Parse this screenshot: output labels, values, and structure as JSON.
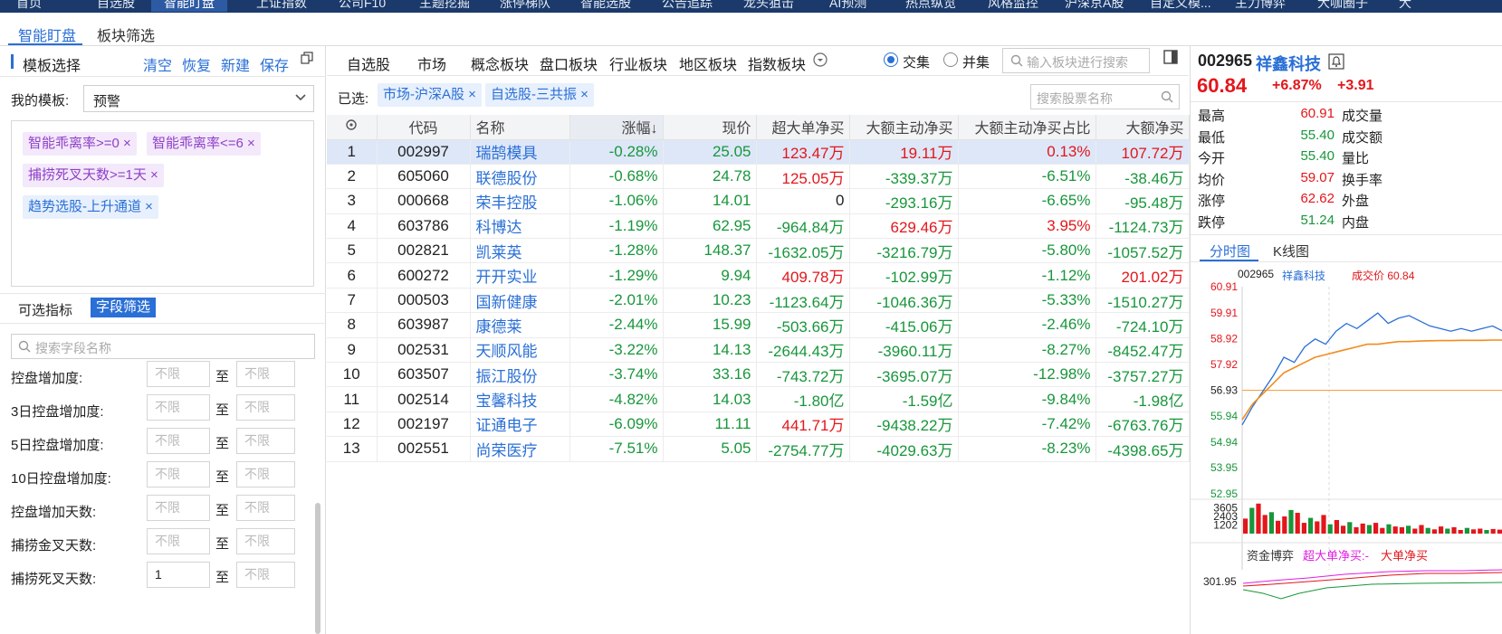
{
  "topnav": {
    "items": [
      "首页",
      "自选股",
      "智能盯盘",
      "上证指数",
      "公司F10",
      "主题挖掘",
      "涨停梯队",
      "智能选股",
      "公告追踪",
      "龙头狙击",
      "AI预测",
      "热点纵览",
      "风格监控",
      "沪深京A股",
      "自定义模...",
      "主力博弈",
      "大咖圈子",
      "大"
    ],
    "active_index": 2
  },
  "subtabs": {
    "items": [
      "智能盯盘",
      "板块筛选"
    ]
  },
  "left": {
    "template_title": "模板选择",
    "actions": [
      "清空",
      "恢复",
      "新建",
      "保存"
    ],
    "my_template_label": "我的模板:",
    "my_template_value": "预警",
    "chips": [
      {
        "text": "智能乖离率>=0 ×"
      },
      {
        "text": "智能乖离率<=6 ×"
      },
      {
        "text": "捕捞死叉天数>=1天 ×"
      },
      {
        "text": "趋势选股-上升通道 ×"
      }
    ],
    "tab_optional": "可选指标",
    "tab_field": "字段筛选",
    "search_placeholder": "搜索字段名称",
    "range_sep": "至",
    "range_placeholder": "不限",
    "fields": [
      {
        "label": "控盘增加度:",
        "min": ""
      },
      {
        "label": "3日控盘增加度:",
        "min": ""
      },
      {
        "label": "5日控盘增加度:",
        "min": ""
      },
      {
        "label": "10日控盘增加度:",
        "min": ""
      },
      {
        "label": "控盘增加天数:",
        "min": ""
      },
      {
        "label": "捕捞金叉天数:",
        "min": ""
      },
      {
        "label": "捕捞死叉天数:",
        "min": "1"
      }
    ]
  },
  "mid": {
    "tabs": [
      "自选股",
      "市场",
      "概念板块",
      "盘口板块",
      "行业板块",
      "地区板块",
      "指数板块"
    ],
    "radio_intersect": "交集",
    "radio_union": "并集",
    "block_search_placeholder": "输入板块进行搜索",
    "selected_label": "已选:",
    "selected_tags": [
      "市场-沪深A股 ×",
      "自选股-三共振 ×"
    ],
    "stock_search_placeholder": "搜索股票名称",
    "columns": [
      "代码",
      "名称",
      "涨幅↓",
      "现价",
      "超大单净买",
      "大额主动净买",
      "大额主动净买占比",
      "大额净买"
    ],
    "rows": [
      {
        "no": "1",
        "code": "002997",
        "name": "瑞鹄模具",
        "chg": "-0.28%",
        "price": "25.05",
        "sbig": "123.47万",
        "sbig_c": "r",
        "act": "19.11万",
        "act_c": "r",
        "ratio": "0.13%",
        "ratio_c": "r",
        "net": "107.72万",
        "net_c": "r"
      },
      {
        "no": "2",
        "code": "605060",
        "name": "联德股份",
        "chg": "-0.68%",
        "price": "24.78",
        "sbig": "125.05万",
        "sbig_c": "r",
        "act": "-339.37万",
        "act_c": "g",
        "ratio": "-6.51%",
        "ratio_c": "g",
        "net": "-38.46万",
        "net_c": "g"
      },
      {
        "no": "3",
        "code": "000668",
        "name": "荣丰控股",
        "chg": "-1.06%",
        "price": "14.01",
        "sbig": "0",
        "sbig_c": "k",
        "act": "-293.16万",
        "act_c": "g",
        "ratio": "-6.65%",
        "ratio_c": "g",
        "net": "-95.48万",
        "net_c": "g"
      },
      {
        "no": "4",
        "code": "603786",
        "name": "科博达",
        "chg": "-1.19%",
        "price": "62.95",
        "sbig": "-964.84万",
        "sbig_c": "g",
        "act": "629.46万",
        "act_c": "r",
        "ratio": "3.95%",
        "ratio_c": "r",
        "net": "-1124.73万",
        "net_c": "g"
      },
      {
        "no": "5",
        "code": "002821",
        "name": "凯莱英",
        "chg": "-1.28%",
        "price": "148.37",
        "sbig": "-1632.05万",
        "sbig_c": "g",
        "act": "-3216.79万",
        "act_c": "g",
        "ratio": "-5.80%",
        "ratio_c": "g",
        "net": "-1057.52万",
        "net_c": "g"
      },
      {
        "no": "6",
        "code": "600272",
        "name": "开开实业",
        "chg": "-1.29%",
        "price": "9.94",
        "sbig": "409.78万",
        "sbig_c": "r",
        "act": "-102.99万",
        "act_c": "g",
        "ratio": "-1.12%",
        "ratio_c": "g",
        "net": "201.02万",
        "net_c": "r"
      },
      {
        "no": "7",
        "code": "000503",
        "name": "国新健康",
        "chg": "-2.01%",
        "price": "10.23",
        "sbig": "-1123.64万",
        "sbig_c": "g",
        "act": "-1046.36万",
        "act_c": "g",
        "ratio": "-5.33%",
        "ratio_c": "g",
        "net": "-1510.27万",
        "net_c": "g"
      },
      {
        "no": "8",
        "code": "603987",
        "name": "康德莱",
        "chg": "-2.44%",
        "price": "15.99",
        "sbig": "-503.66万",
        "sbig_c": "g",
        "act": "-415.06万",
        "act_c": "g",
        "ratio": "-2.46%",
        "ratio_c": "g",
        "net": "-724.10万",
        "net_c": "g"
      },
      {
        "no": "9",
        "code": "002531",
        "name": "天顺风能",
        "chg": "-3.22%",
        "price": "14.13",
        "sbig": "-2644.43万",
        "sbig_c": "g",
        "act": "-3960.11万",
        "act_c": "g",
        "ratio": "-8.27%",
        "ratio_c": "g",
        "net": "-8452.47万",
        "net_c": "g"
      },
      {
        "no": "10",
        "code": "603507",
        "name": "振江股份",
        "chg": "-3.74%",
        "price": "33.16",
        "sbig": "-743.72万",
        "sbig_c": "g",
        "act": "-3695.07万",
        "act_c": "g",
        "ratio": "-12.98%",
        "ratio_c": "g",
        "net": "-3757.27万",
        "net_c": "g"
      },
      {
        "no": "11",
        "code": "002514",
        "name": "宝馨科技",
        "chg": "-4.82%",
        "price": "14.03",
        "sbig": "-1.80亿",
        "sbig_c": "g",
        "act": "-1.59亿",
        "act_c": "g",
        "ratio": "-9.84%",
        "ratio_c": "g",
        "net": "-1.98亿",
        "net_c": "g"
      },
      {
        "no": "12",
        "code": "002197",
        "name": "证通电子",
        "chg": "-6.09%",
        "price": "11.11",
        "sbig": "441.71万",
        "sbig_c": "r",
        "act": "-9438.22万",
        "act_c": "g",
        "ratio": "-7.42%",
        "ratio_c": "g",
        "net": "-6763.76万",
        "net_c": "g"
      },
      {
        "no": "13",
        "code": "002551",
        "name": "尚荣医疗",
        "chg": "-7.51%",
        "price": "5.05",
        "sbig": "-2754.77万",
        "sbig_c": "g",
        "act": "-4029.63万",
        "act_c": "g",
        "ratio": "-8.23%",
        "ratio_c": "g",
        "net": "-4398.65万",
        "net_c": "g"
      }
    ]
  },
  "quote": {
    "code": "002965",
    "name": "祥鑫科技",
    "price": "60.84",
    "chg_pct": "+6.87%",
    "chg": "+3.91",
    "stats": [
      {
        "k": "最高",
        "v": "60.91",
        "k2": "成交量"
      },
      {
        "k": "最低",
        "v": "55.40",
        "k2": "成交额"
      },
      {
        "k": "今开",
        "v": "55.40",
        "k2": "量比"
      },
      {
        "k": "均价",
        "v": "59.07",
        "k2": "换手率"
      },
      {
        "k": "涨停",
        "v": "62.62",
        "k2": "外盘"
      },
      {
        "k": "跌停",
        "v": "51.24",
        "k2": "内盘"
      }
    ],
    "chart_tabs": [
      "分时图",
      "K线图"
    ],
    "chart_header_code": "002965",
    "chart_header_name": "祥鑫科技",
    "chart_header_price": "成交价 60.84",
    "price_ticks": [
      "60.91",
      "59.91",
      "58.92",
      "57.92",
      "56.93",
      "55.94",
      "54.94",
      "53.95",
      "52.95"
    ],
    "vol_ticks": [
      "3605",
      "2403",
      "1202"
    ],
    "fund_label": "资金博弈",
    "fund_sbig": "超大单净买:-",
    "fund_big": "大单净买",
    "fund_tick": "301.95",
    "colors": {
      "up": "#e3161b",
      "down": "#18963b",
      "accent": "#2a6fd6",
      "avg_line": "#f28c1c",
      "price_line": "#2a6fd6"
    }
  },
  "chart_data": {
    "type": "line",
    "title": "",
    "xlabel": "",
    "ylabel": "",
    "ylim": [
      52.95,
      60.91
    ],
    "prev_close": 56.93,
    "series": [
      {
        "values": [
          55.6,
          56.3,
          56.9,
          57.5,
          58.2,
          58.0,
          58.6,
          58.9,
          58.7,
          59.2,
          59.5,
          59.3,
          59.6,
          59.9,
          59.5,
          59.7,
          59.8,
          59.6,
          59.4,
          59.3,
          59.2,
          59.3,
          59.2,
          59.3,
          59.4,
          59.2
        ]
      },
      {
        "values": [
          55.8,
          56.4,
          56.8,
          57.2,
          57.6,
          57.8,
          58.0,
          58.2,
          58.3,
          58.4,
          58.5,
          58.6,
          58.7,
          58.7,
          58.75,
          58.8,
          58.8,
          58.82,
          58.83,
          58.84,
          58.84,
          58.85,
          58.85,
          58.85,
          58.86,
          58.86
        ]
      }
    ],
    "volume": {
      "ylim": [
        0,
        4800
      ],
      "values": [
        2100,
        3600,
        4200,
        2600,
        3000,
        1800,
        2400,
        3300,
        2900,
        1500,
        2200,
        1700,
        2600,
        1300,
        1900,
        1100,
        1600,
        900,
        1400,
        1200,
        1500,
        800,
        1300,
        1000,
        900,
        1100,
        700,
        1200,
        800,
        600,
        1000,
        700,
        900,
        500,
        800,
        600,
        700,
        500,
        650,
        550
      ]
    }
  }
}
